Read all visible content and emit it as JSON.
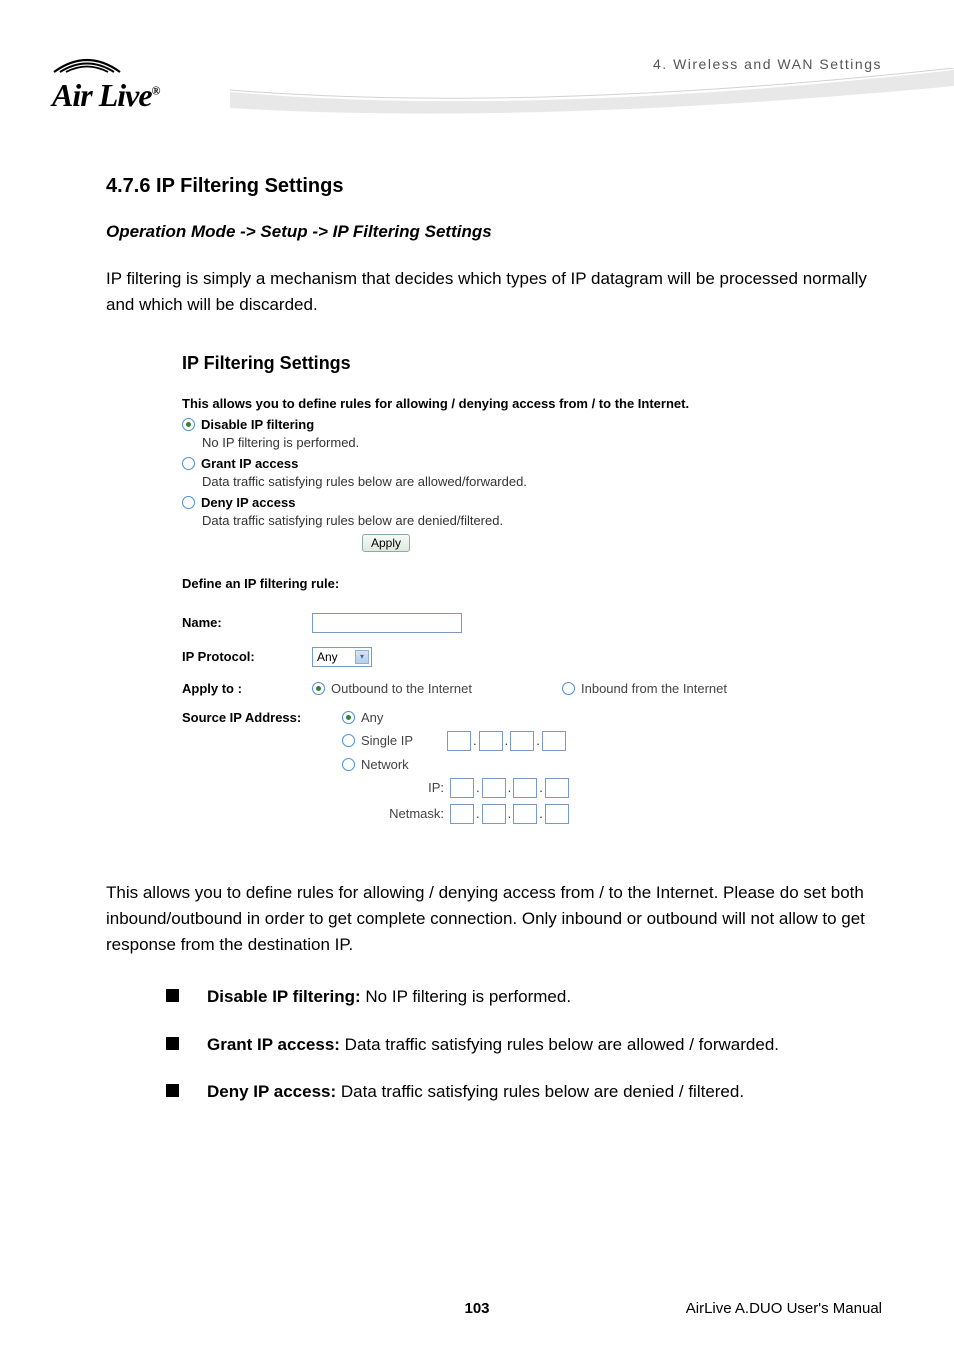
{
  "header": {
    "chapter": "4. Wireless and WAN Settings",
    "logo_text": "Air Live",
    "logo_reg": "®"
  },
  "section": {
    "title": "4.7.6 IP Filtering Settings",
    "breadcrumb": "Operation Mode -> Setup -> IP Filtering Settings",
    "intro": "IP filtering is simply a mechanism that decides which types of IP datagram will be processed normally and which will be discarded."
  },
  "screenshot": {
    "title": "IP Filtering Settings",
    "desc": "This allows you to define rules for allowing / denying access from / to the Internet.",
    "modes": {
      "disable": {
        "label": "Disable IP filtering",
        "sub": "No IP filtering is performed."
      },
      "grant": {
        "label": "Grant IP access",
        "sub": "Data traffic satisfying rules below are allowed/forwarded."
      },
      "deny": {
        "label": "Deny IP access",
        "sub": "Data traffic satisfying rules below are denied/filtered."
      }
    },
    "apply_btn": "Apply",
    "define_label": "Define an IP filtering rule:",
    "form": {
      "name_label": "Name:",
      "protocol_label": "IP Protocol:",
      "protocol_value": "Any",
      "applyto_label": "Apply to :",
      "applyto_out": "Outbound to the Internet",
      "applyto_in": "Inbound from the Internet",
      "src_label": "Source IP Address:",
      "src_any": "Any",
      "src_single": "Single IP",
      "src_network": "Network",
      "src_ip": "IP:",
      "src_netmask": "Netmask:"
    }
  },
  "after": {
    "text": "This allows you to define rules for allowing / denying access from / to the Internet. Please do set both inbound/outbound in order to get complete connection. Only inbound or outbound will not allow to get response from the destination IP.",
    "bullets": [
      {
        "bold": "Disable IP filtering:",
        "rest": " No IP filtering is performed."
      },
      {
        "bold": "Grant IP access:",
        "rest": " Data traffic satisfying rules below are allowed / forwarded."
      },
      {
        "bold": "Deny IP access:",
        "rest": " Data traffic satisfying rules below are denied / filtered."
      }
    ]
  },
  "footer": {
    "page": "103",
    "manual": "AirLive A.DUO User's Manual"
  }
}
